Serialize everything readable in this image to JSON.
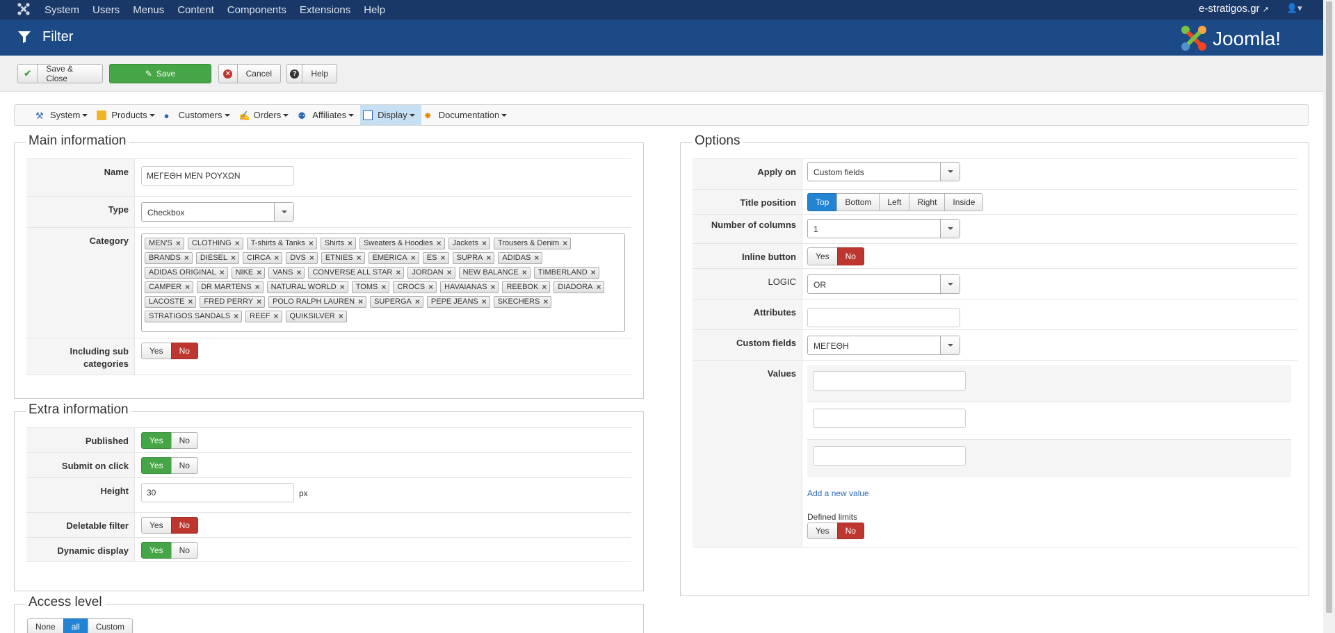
{
  "topbar": {
    "menu": [
      "System",
      "Users",
      "Menus",
      "Content",
      "Components",
      "Extensions",
      "Help"
    ],
    "site": "e-stratigos.gr"
  },
  "header": {
    "title": "Filter",
    "brand": "Joomla!"
  },
  "toolbar": {
    "save_close": "Save & Close",
    "save": "Save",
    "cancel": "Cancel",
    "help": "Help"
  },
  "subnav": {
    "items": [
      "System",
      "Products",
      "Customers",
      "Orders",
      "Affiliates",
      "Display",
      "Documentation"
    ],
    "active": "Display"
  },
  "main_info": {
    "legend": "Main information",
    "name_label": "Name",
    "name_value": "ΜΕΓΕΘΗ ΜΕΝ ΡΟΥΧΩΝ",
    "type_label": "Type",
    "type_value": "Checkbox",
    "category_label": "Category",
    "categories": [
      "MEN'S",
      "CLOTHING",
      "T-shirts & Tanks",
      "Shirts",
      "Sweaters & Hoodies",
      "Jackets",
      "Trousers & Denim",
      "BRANDS",
      "DIESEL",
      "CIRCA",
      "DVS",
      "ETNIES",
      "EMERICA",
      "ES",
      "SUPRA",
      "ADIDAS",
      "ADIDAS ORIGINAL",
      "NIKE",
      "VANS",
      "CONVERSE ALL STAR",
      "JORDAN",
      "NEW BALANCE",
      "TIMBERLAND",
      "CAMPER",
      "DR MARTENS",
      "NATURAL WORLD",
      "TOMS",
      "CROCS",
      "HAVAIANAS",
      "REEBOK",
      "DIADORA",
      "LACOSTE",
      "FRED PERRY",
      "POLO RALPH LAUREN",
      "SUPERGA",
      "PEPE JEANS",
      "SKECHERS",
      "STRATIGOS SANDALS",
      "REEF",
      "QUIKSILVER"
    ],
    "subcat_label": "Including sub categories",
    "yes": "Yes",
    "no": "No"
  },
  "extra_info": {
    "legend": "Extra information",
    "published_label": "Published",
    "submit_label": "Submit on click",
    "height_label": "Height",
    "height_value": "30",
    "height_unit": "px",
    "deletable_label": "Deletable filter",
    "dynamic_label": "Dynamic display",
    "yes": "Yes",
    "no": "No"
  },
  "access": {
    "legend": "Access level",
    "options": [
      "None",
      "all",
      "Custom"
    ]
  },
  "options": {
    "legend": "Options",
    "apply_label": "Apply on",
    "apply_value": "Custom fields",
    "title_pos_label": "Title position",
    "title_pos": [
      "Top",
      "Bottom",
      "Left",
      "Right",
      "Inside"
    ],
    "columns_label": "Number of columns",
    "columns_value": "1",
    "inline_label": "Inline button",
    "logic_label": "LOGIC",
    "logic_value": "OR",
    "attributes_label": "Attributes",
    "custom_fields_label": "Custom fields",
    "custom_fields_value": "ΜΕΓΕΘΗ",
    "values_label": "Values",
    "add_value": "Add a new value",
    "defined_limits": "Defined limits",
    "yes": "Yes",
    "no": "No"
  },
  "colors": {
    "green": "#46a546",
    "red": "#bd362f",
    "blue": "#2384d3",
    "navy": "#1a3867"
  }
}
